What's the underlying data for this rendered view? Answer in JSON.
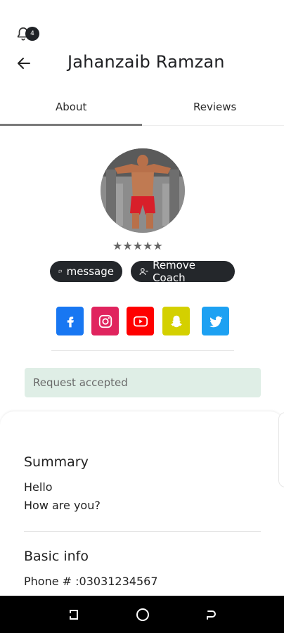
{
  "notification": {
    "icon": "bell-icon",
    "badge": "4"
  },
  "header": {
    "back_icon": "arrow-left-icon",
    "title": "Jahanzaib Ramzan"
  },
  "tabs": [
    {
      "label": "About",
      "active": true
    },
    {
      "label": "Reviews",
      "active": false
    }
  ],
  "profile": {
    "avatar": "profile-photo",
    "stars": "★★★★★",
    "rating": 0
  },
  "actions": {
    "message_label": "message",
    "remove_label": "Remove Coach"
  },
  "social": [
    "facebook-icon",
    "instagram-icon",
    "youtube-icon",
    "snapchat-icon",
    "twitter-icon"
  ],
  "status": {
    "request": "Request accepted"
  },
  "summary": {
    "title": "Summary",
    "line1": "Hello",
    "line2": "How are you?"
  },
  "basic_info": {
    "title": "Basic info",
    "phone": "Phone # :03031234567"
  },
  "colors": {
    "facebook": "#1877f2",
    "instagram": "#e0245e",
    "youtube": "#ff0000",
    "snapchat": "#d4d000",
    "twitter": "#1da1f2",
    "request_bg": "#dfeee6",
    "pill_bg": "#24272b"
  }
}
